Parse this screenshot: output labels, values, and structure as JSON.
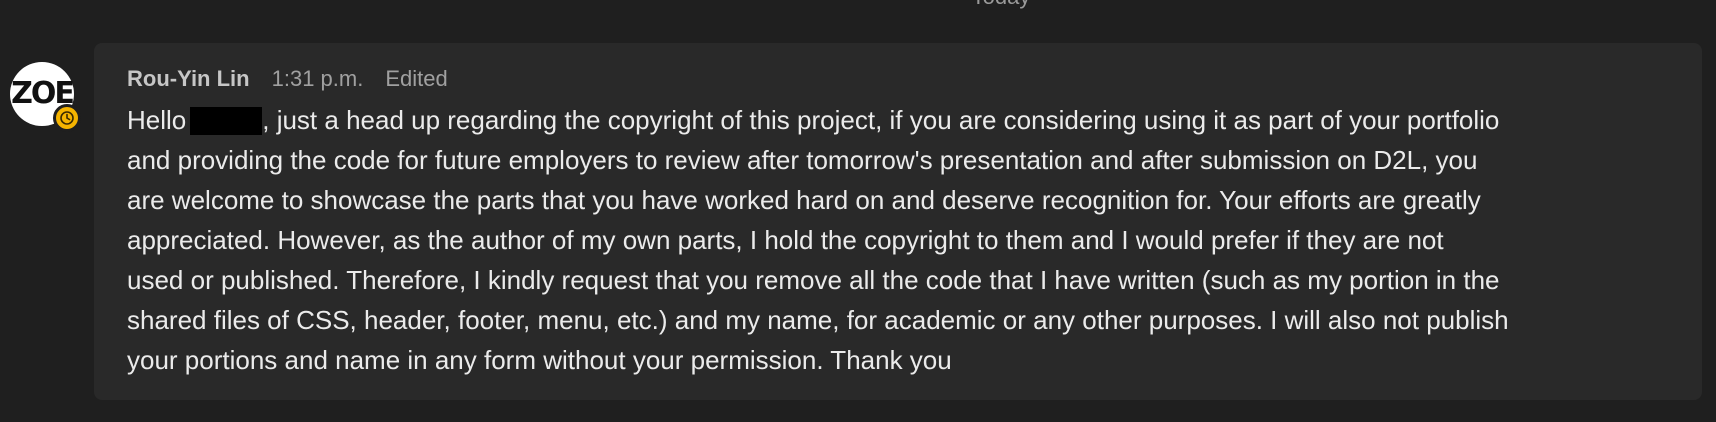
{
  "date_divider": "Today",
  "avatar": {
    "initials": "ZOE",
    "presence_color": "#f5b400"
  },
  "message": {
    "author": "Rou-Yin Lin",
    "time": "1:31 p.m.",
    "edited": "Edited",
    "greeting": "Hello",
    "lines": [
      ", just a head up regarding the copyright of this project, if you are considering using it as part of your portfolio",
      "and providing the code for future employers to review after tomorrow's presentation and after submission on D2L, you",
      "are welcome to showcase the parts that you have worked hard on and deserve recognition for. Your efforts are greatly",
      "appreciated. However, as the author of my own parts, I hold the copyright to them and I would prefer if they are not",
      "used or published. Therefore, I kindly request that you remove all the code that I have written (such as my portion in the",
      "shared files of CSS, header, footer, menu, etc.) and my name, for academic or any other purposes. I will also not publish",
      "your portions and name in any form without your permission. Thank you"
    ]
  },
  "colors": {
    "background": "#1f1f1f",
    "bubble": "#292929",
    "text": "#ebebeb",
    "meta": "#a0a0a0"
  }
}
